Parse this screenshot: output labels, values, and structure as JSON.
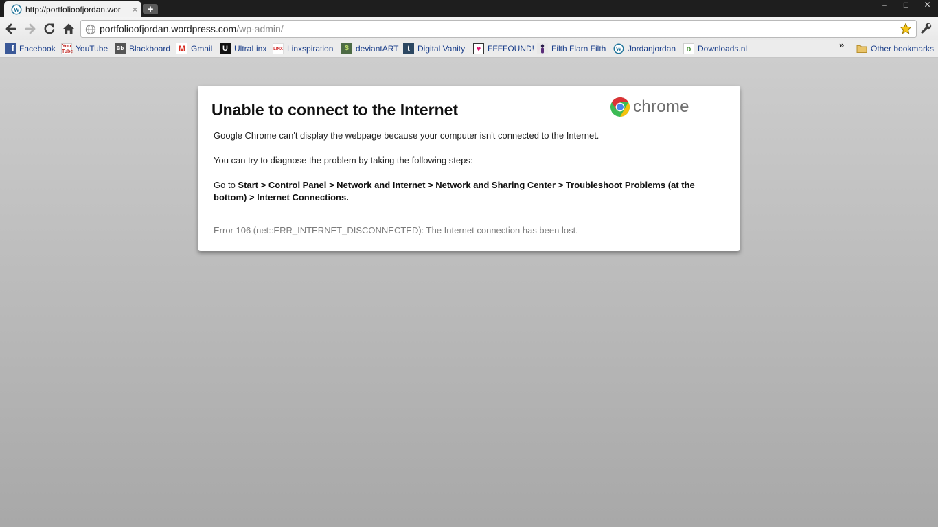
{
  "tab": {
    "title": "http://portfolioofjordan.wor",
    "close": "×",
    "new_tab": "+"
  },
  "window_controls": {
    "minimize": "–",
    "maximize": "□",
    "close": "✕"
  },
  "omnibox": {
    "host": "portfolioofjordan.wordpress.com",
    "path": "/wp-admin/"
  },
  "bookmarks": [
    {
      "label": "Facebook",
      "icon": "facebook-icon"
    },
    {
      "label": "YouTube",
      "icon": "youtube-icon"
    },
    {
      "label": "Blackboard",
      "icon": "blackboard-icon"
    },
    {
      "label": "Gmail",
      "icon": "gmail-icon"
    },
    {
      "label": "UltraLinx",
      "icon": "ultralinx-icon"
    },
    {
      "label": "Linxspiration",
      "icon": "linxspiration-icon"
    },
    {
      "label": "deviantART",
      "icon": "deviantart-icon"
    },
    {
      "label": "Digital Vanity",
      "icon": "tumblr-icon"
    },
    {
      "label": "FFFFOUND!",
      "icon": "ffffound-icon"
    },
    {
      "label": "Filth Flarn Filth",
      "icon": "filth-flarn-filth-icon"
    },
    {
      "label": "Jordanjordan",
      "icon": "wordpress-icon"
    },
    {
      "label": "Downloads.nl",
      "icon": "downloads-nl-icon"
    }
  ],
  "bookmarks_overflow": "»",
  "other_bookmarks": "Other bookmarks",
  "error_page": {
    "title": "Unable to connect to the Internet",
    "logo_text": "chrome",
    "line1": "Google Chrome can't display the webpage because your computer isn't connected to the Internet.",
    "line2": "You can try to diagnose the problem by taking the following steps:",
    "steps_prefix": "Go to ",
    "steps_path": "Start > Control Panel > Network and Internet > Network and Sharing Center > Troubleshoot Problems (at the bottom) > Internet Connections.",
    "error_line": "Error 106 (net::ERR_INTERNET_DISCONNECTED): The Internet connection has been lost."
  }
}
